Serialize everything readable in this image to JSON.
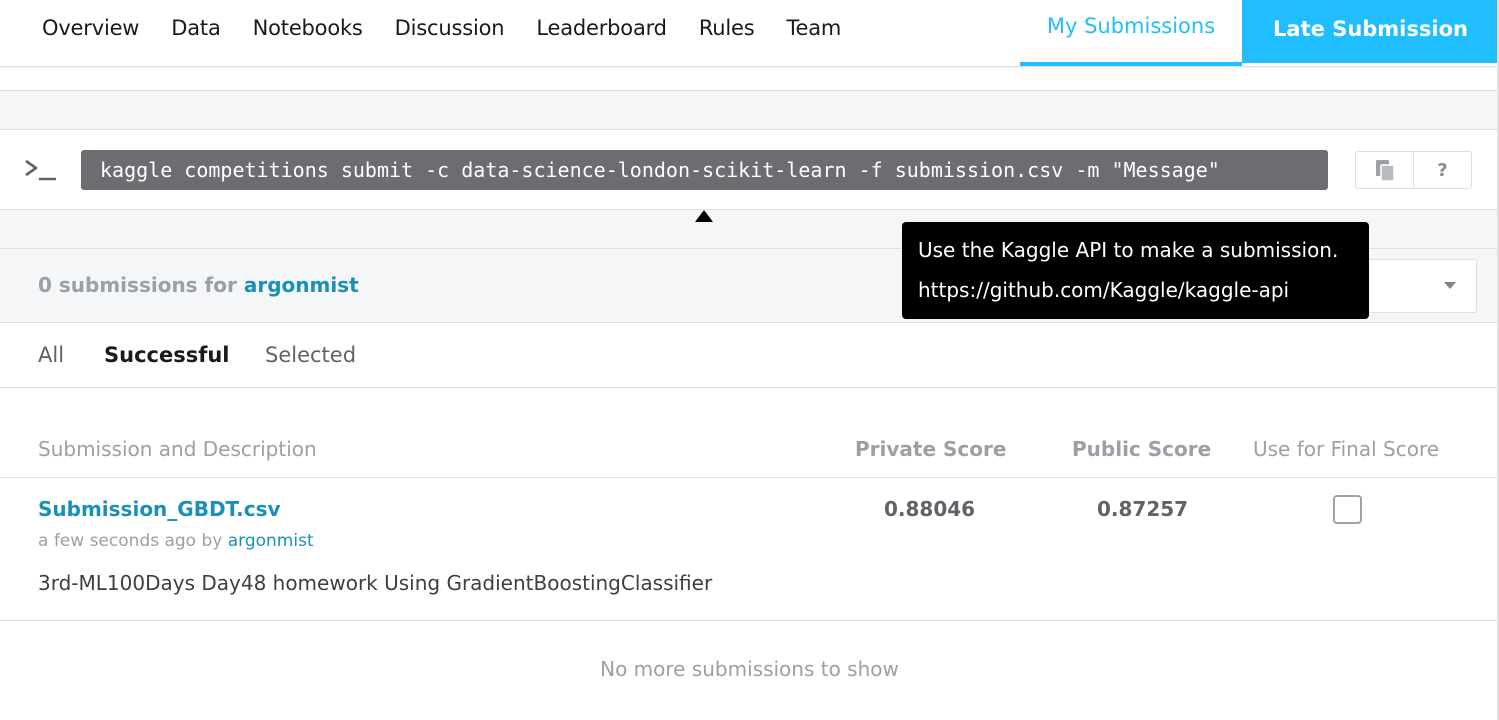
{
  "nav": {
    "tabs": [
      "Overview",
      "Data",
      "Notebooks",
      "Discussion",
      "Leaderboard",
      "Rules",
      "Team"
    ],
    "my_submissions": "My Submissions",
    "late_submission": "Late Submission"
  },
  "api": {
    "command": "kaggle competitions submit -c data-science-london-scikit-learn -f submission.csv -m \"Message\"",
    "icons": [
      "terminal-icon",
      "copy-icon",
      "help-icon"
    ],
    "help_label": "?"
  },
  "tooltip": {
    "line1": "Use the Kaggle API to make a submission.",
    "line2": "https://github.com/Kaggle/kaggle-api"
  },
  "submissions": {
    "count_prefix": "0 submissions for",
    "user": "argonmist",
    "filters": [
      "All",
      "Successful",
      "Selected"
    ],
    "active_filter": "Successful",
    "columns": {
      "description": "Submission and Description",
      "private": "Private Score",
      "public": "Public Score",
      "final": "Use for Final Score"
    },
    "rows": [
      {
        "name": "Submission_GBDT.csv",
        "time": "a few seconds ago by",
        "user": "argonmist",
        "description": "3rd-ML100Days Day48 homework Using GradientBoostingClassifier",
        "private_score": "0.88046",
        "public_score": "0.87257",
        "selected": false
      }
    ],
    "empty_message": "No more submissions to show"
  },
  "colors": {
    "accent": "#20beff",
    "link": "#1a8fb8",
    "command_bg": "#6b6d70"
  }
}
